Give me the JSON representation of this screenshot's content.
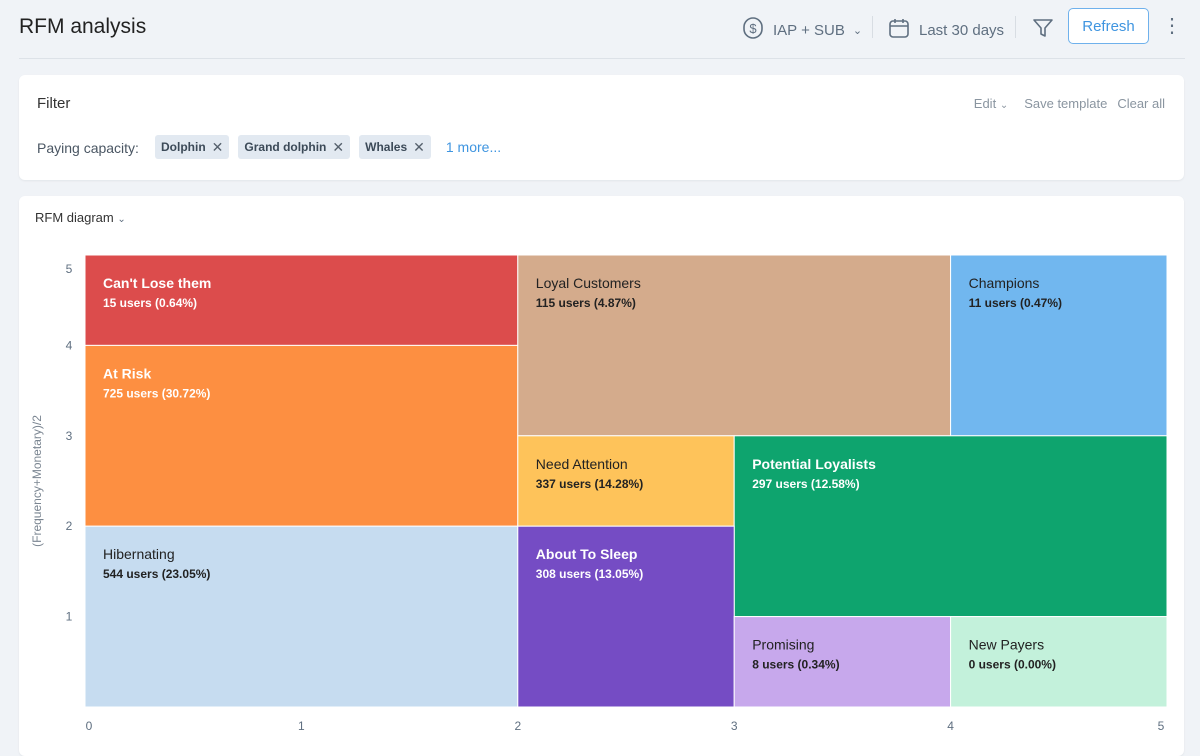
{
  "header": {
    "title": "RFM analysis",
    "revenue_type": "IAP + SUB",
    "date_range": "Last 30 days",
    "refresh_label": "Refresh"
  },
  "filter": {
    "title": "Filter",
    "edit_label": "Edit",
    "save_template_label": "Save template",
    "clear_all_label": "Clear all",
    "paying_capacity_label": "Paying capacity:",
    "chips": [
      "Dolphin",
      "Grand dolphin",
      "Whales"
    ],
    "more_label": "1 more..."
  },
  "chart_card": {
    "selector_label": "RFM diagram"
  },
  "chart_data": {
    "type": "treemap",
    "ylabel": "(Frequency+Monetary)/2",
    "xlabel": "",
    "xlim": [
      0,
      5
    ],
    "ylim": [
      0,
      5
    ],
    "xticks": [
      "0",
      "1",
      "2",
      "3",
      "4",
      "5"
    ],
    "yticks": [
      "1",
      "2",
      "3",
      "4",
      "5"
    ],
    "segments": [
      {
        "name": "Can't Lose them",
        "users": "15 users (0.64%)",
        "x": [
          0,
          2
        ],
        "y": [
          4,
          5
        ],
        "color": "#dc4c4c",
        "text": "#ffffff"
      },
      {
        "name": "At Risk",
        "users": "725 users (30.72%)",
        "x": [
          0,
          2
        ],
        "y": [
          2,
          4
        ],
        "color": "#fd8f41",
        "text": "#ffffff"
      },
      {
        "name": "Hibernating",
        "users": "544 users (23.05%)",
        "x": [
          0,
          2
        ],
        "y": [
          0,
          2
        ],
        "color": "#c6dcf0",
        "text": "#222222"
      },
      {
        "name": "Loyal Customers",
        "users": "115 users (4.87%)",
        "x": [
          2,
          4
        ],
        "y": [
          3,
          5
        ],
        "color": "#d4ab8c",
        "text": "#222222"
      },
      {
        "name": "Champions",
        "users": "11 users (0.47%)",
        "x": [
          4,
          5
        ],
        "y": [
          3,
          5
        ],
        "color": "#71b7ef",
        "text": "#222222"
      },
      {
        "name": "Need Attention",
        "users": "337 users (14.28%)",
        "x": [
          2,
          3
        ],
        "y": [
          2,
          3
        ],
        "color": "#fec35a",
        "text": "#222222"
      },
      {
        "name": "Potential Loyalists",
        "users": "297 users (12.58%)",
        "x": [
          3,
          5
        ],
        "y": [
          1,
          3
        ],
        "color": "#0ea46e",
        "text": "#ffffff"
      },
      {
        "name": "About To Sleep",
        "users": "308 users (13.05%)",
        "x": [
          2,
          3
        ],
        "y": [
          0,
          2
        ],
        "color": "#754cc4",
        "text": "#ffffff"
      },
      {
        "name": "Promising",
        "users": "8 users (0.34%)",
        "x": [
          3,
          4
        ],
        "y": [
          0,
          1
        ],
        "color": "#c7a8ec",
        "text": "#222222"
      },
      {
        "name": "New Payers",
        "users": "0 users (0.00%)",
        "x": [
          4,
          5
        ],
        "y": [
          0,
          1
        ],
        "color": "#c3f1db",
        "text": "#222222"
      }
    ]
  }
}
